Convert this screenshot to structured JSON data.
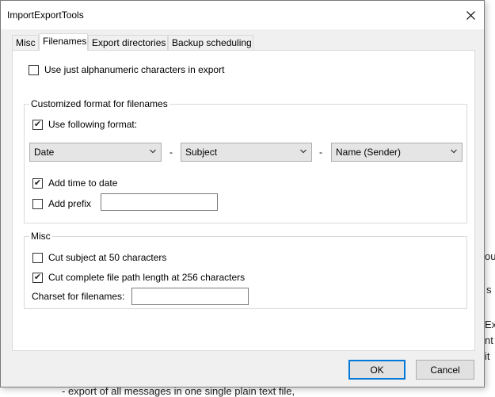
{
  "background": {
    "fragments": [
      "o",
      "s",
      "ou",
      "s",
      "Ex",
      "nt",
      "it",
      "- export of all messages in one single plain text file,"
    ]
  },
  "dialog": {
    "title": "ImportExportTools",
    "tabs": [
      {
        "label": "Misc",
        "active": false
      },
      {
        "label": "Filenames",
        "active": true
      },
      {
        "label": "Export directories",
        "active": false
      },
      {
        "label": "Backup scheduling",
        "active": false
      }
    ],
    "alnum_label": "Use just alphanumeric characters in export",
    "alnum_checked": false,
    "custom_group": {
      "legend": "Customized format for filenames",
      "use_format_label": "Use following format:",
      "use_format_checked": true,
      "select1": "Date",
      "select2": "Subject",
      "select3": "Name (Sender)",
      "separator": "-",
      "add_time_label": "Add time to date",
      "add_time_checked": true,
      "add_prefix_label": "Add prefix",
      "add_prefix_checked": false,
      "prefix_value": ""
    },
    "misc_group": {
      "legend": "Misc",
      "cut_subject_label": "Cut subject at 50 characters",
      "cut_subject_checked": false,
      "cut_path_label": "Cut complete file path length at 256 characters",
      "cut_path_checked": true,
      "charset_label": "Charset for filenames:",
      "charset_value": ""
    },
    "ok_label": "OK",
    "cancel_label": "Cancel"
  }
}
